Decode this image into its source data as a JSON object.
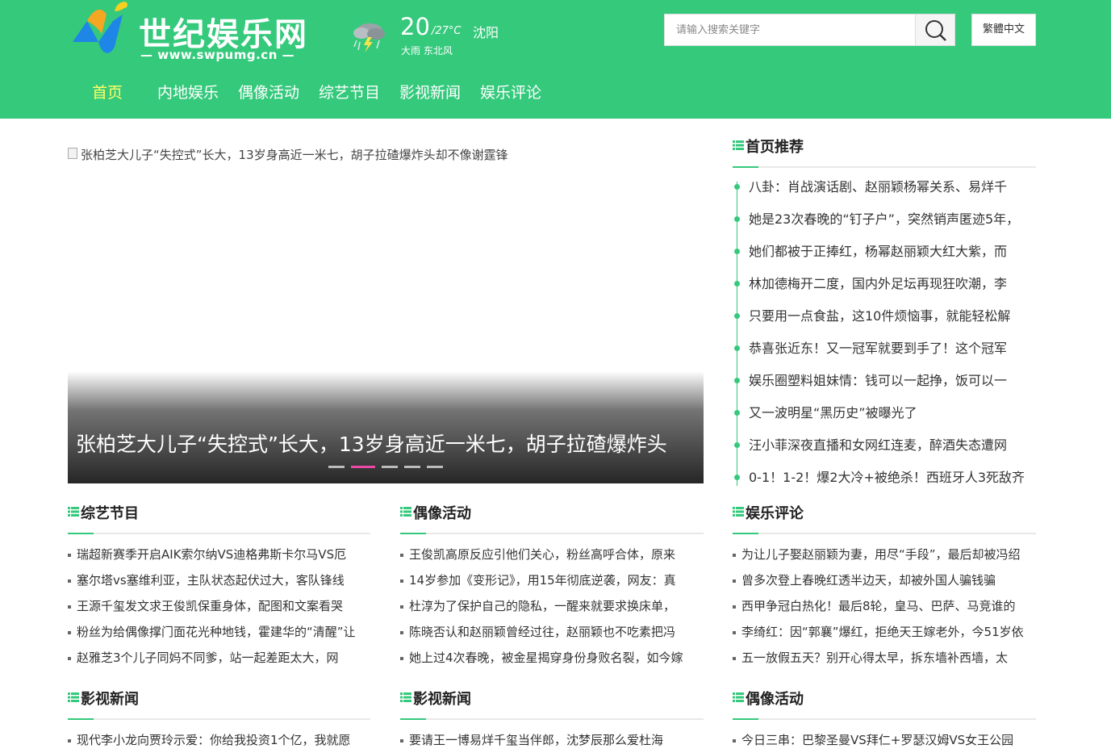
{
  "site": {
    "logo_title": "世纪娱乐网",
    "logo_url": "— www.swpumg.cn —"
  },
  "weather": {
    "temp": "20",
    "range": "/27°C",
    "city": "沈阳",
    "desc": "大雨 东北风",
    "icon": "thunderstorm-cloud-icon"
  },
  "search": {
    "placeholder": "请输入搜索关键字",
    "value": "",
    "icon": "search-icon"
  },
  "lang_toggle": "繁體中文",
  "nav": [
    {
      "label": "首页",
      "active": true
    },
    {
      "label": "内地娱乐"
    },
    {
      "label": "偶像活动"
    },
    {
      "label": "综艺节目"
    },
    {
      "label": "影视新闻"
    },
    {
      "label": "娱乐评论"
    }
  ],
  "slider": {
    "image_alt": "张柏芝大儿子“失控式”长大，13岁身高近一米七，胡子拉碴爆炸头却不像谢霆锋",
    "caption": "张柏芝大儿子“失控式”长大，13岁身高近一米七，胡子拉碴爆炸头",
    "active_dot": 2,
    "dot_count": 5
  },
  "recommend": {
    "title": "首页推荐",
    "items": [
      "八卦：肖战演话剧、赵丽颖杨幂关系、易烊千",
      "她是23次春晚的“钉子户”，突然销声匿迹5年，",
      "她们都被于正捧红，杨幂赵丽颖大红大紫，而",
      "林加德梅开二度，国内外足坛再现狂吹潮，李",
      "只要用一点食盐，这10件烦恼事，就能轻松解",
      "恭喜张近东！又一冠军就要到手了！这个冠军",
      "娱乐圈塑料姐妹情：钱可以一起挣，饭可以一",
      "又一波明星“黑历史”被曝光了",
      "汪小菲深夜直播和女网红连麦，醉酒失态遭网",
      "0-1！1-2！爆2大冷+被绝杀！西班牙人3死敌齐"
    ]
  },
  "sections_row1": [
    {
      "title": "综艺节目",
      "items": [
        "瑞超新赛季开启AIK索尔纳VS迪格弗斯卡尔马VS厄",
        "塞尔塔vs塞维利亚，主队状态起伏过大，客队锋线",
        "王源千玺发文求王俊凯保重身体，配图和文案看哭",
        "粉丝为给偶像撑门面花光种地钱，霍建华的“清醒”让",
        "赵雅芝3个儿子同妈不同爹，站一起差距太大，网"
      ]
    },
    {
      "title": "偶像活动",
      "items": [
        "王俊凯高原反应引他们关心，粉丝高呼合体，原来",
        "14岁参加《变形记》，用15年彻底逆袭，网友：真",
        "杜淳为了保护自己的隐私，一醒来就要求换床单，",
        "陈晓否认和赵丽颖曾经过往，赵丽颖也不吃素把冯",
        "她上过4次春晚，被金星揭穿身份身败名裂，如今嫁"
      ]
    },
    {
      "title": "娱乐评论",
      "items": [
        "为让儿子娶赵丽颖为妻，用尽“手段”，最后却被冯绍",
        "曾多次登上春晚红透半边天，却被外国人骗钱骗",
        "西甲争冠白热化！最后8轮，皇马、巴萨、马竞谁的",
        "李绮红：因“郭襄”爆红，拒绝天王嫁老外，今51岁依",
        "五一放假五天？别开心得太早，拆东墙补西墙，太"
      ]
    }
  ],
  "sections_row2": [
    {
      "title": "影视新闻",
      "items": [
        "现代李小龙向贾玲示爱：你给我投资1个亿，我就愿"
      ]
    },
    {
      "title": "影视新闻",
      "items": [
        "要请王一博易烊千玺当伴郎，沈梦辰那么爱杜海"
      ]
    },
    {
      "title": "偶像活动",
      "items": [
        "今日三串：巴黎圣曼VS拜仁+罗瑟汉姆VS女王公园"
      ]
    }
  ],
  "colors": {
    "brand_green": "#35c97c",
    "nav_active": "#ffff66",
    "dot_active": "#e94aa6"
  }
}
